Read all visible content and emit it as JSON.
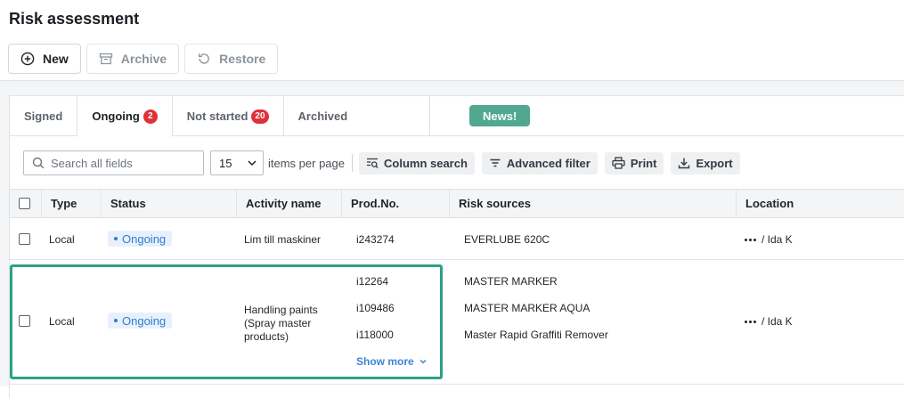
{
  "page": {
    "title": "Risk assessment"
  },
  "toolbar": {
    "new_label": "New",
    "archive_label": "Archive",
    "restore_label": "Restore"
  },
  "tabs": [
    {
      "label": "Signed",
      "badge": ""
    },
    {
      "label": "Ongoing",
      "badge": "2"
    },
    {
      "label": "Not started",
      "badge": "20"
    },
    {
      "label": "Archived",
      "badge": ""
    }
  ],
  "news_label": "News!",
  "filters": {
    "search_placeholder": "Search all fields",
    "per_page_value": "15",
    "per_page_label": "items per page",
    "column_search_label": "Column search",
    "advanced_filter_label": "Advanced filter",
    "print_label": "Print",
    "export_label": "Export"
  },
  "table": {
    "columns": [
      "Type",
      "Status",
      "Activity name",
      "Prod.No.",
      "Risk sources",
      "Location"
    ],
    "rows": [
      {
        "type": "Local",
        "status": "Ongoing",
        "activity": "Lim till maskiner",
        "prod_nos": [
          "i243274"
        ],
        "risk_sources": [
          "EVERLUBE 620C"
        ],
        "location": "/ Ida K"
      },
      {
        "type": "Local",
        "status": "Ongoing",
        "activity_lines": [
          "Handling paints",
          "(Spray master",
          "products)"
        ],
        "prod_nos": [
          "i12264",
          "i109486",
          "i118000"
        ],
        "risk_sources": [
          "MASTER MARKER",
          "MASTER MARKER AQUA",
          "Master Rapid Graffiti Remover"
        ],
        "show_more_label": "Show more",
        "location": "/ Ida K"
      }
    ]
  },
  "colors": {
    "accent_green": "#52a88e",
    "highlight": "#2aa287",
    "badge_red": "#e0313a",
    "status_blue": "#2f7dd1"
  }
}
